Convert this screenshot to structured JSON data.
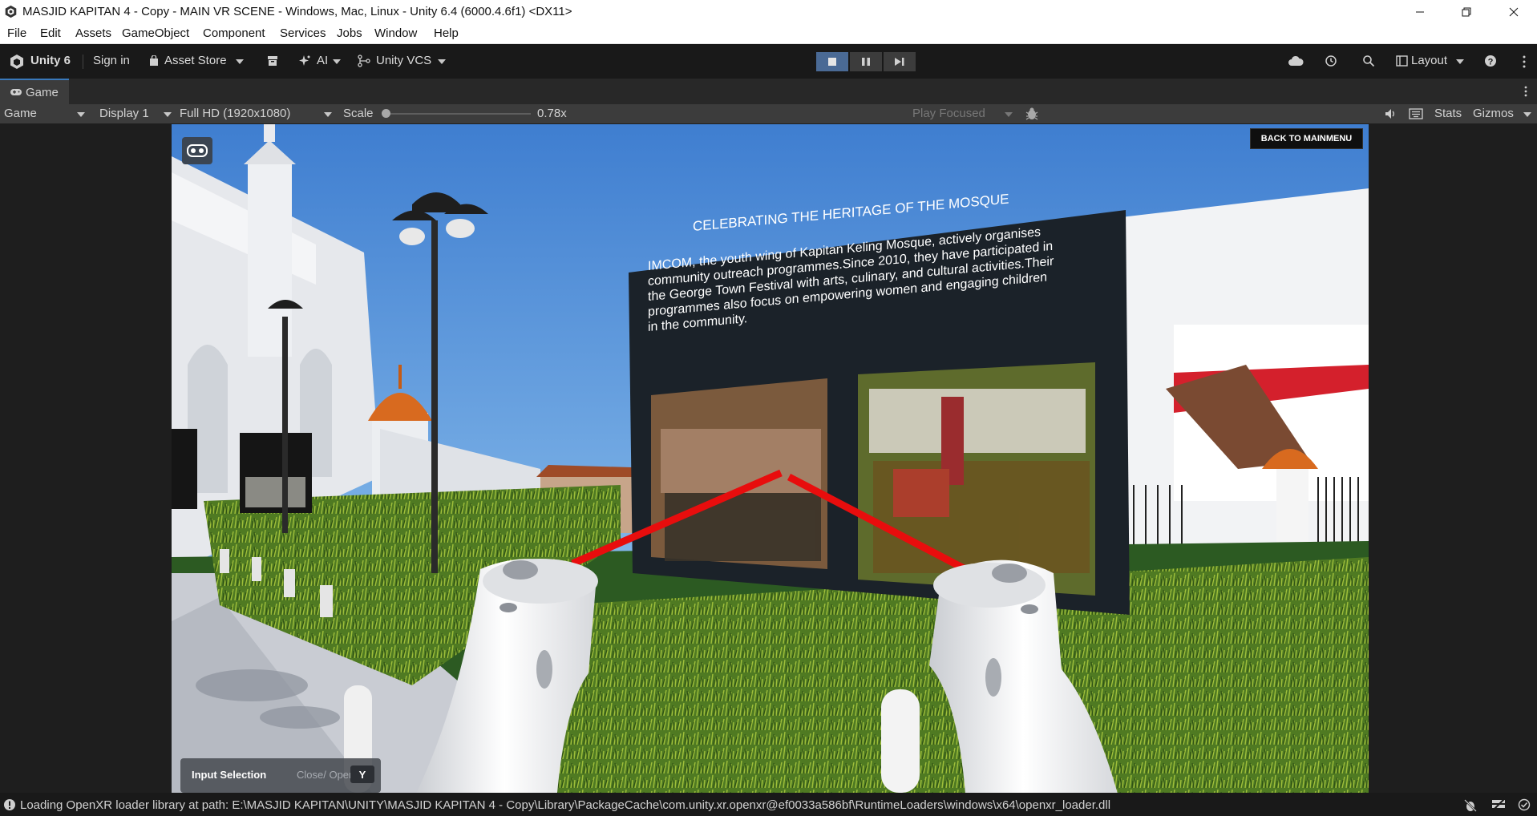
{
  "window": {
    "title": "MASJID KAPITAN 4 - Copy - MAIN VR SCENE - Windows, Mac, Linux - Unity 6.4 (6000.4.6f1) <DX11>"
  },
  "menu": [
    "File",
    "Edit",
    "Assets",
    "GameObject",
    "Component",
    "Services",
    "Jobs",
    "Window",
    "Help"
  ],
  "toolbar": {
    "unity_label": "Unity 6",
    "sign_in": "Sign in",
    "asset_store": "Asset Store",
    "ai": "AI",
    "vcs": "Unity VCS",
    "layout": "Layout"
  },
  "tab": {
    "game": "Game"
  },
  "game_toolbar": {
    "view_mode": "Game",
    "display": "Display 1",
    "resolution": "Full HD (1920x1080)",
    "scale_label": "Scale",
    "scale_value": "0.78x",
    "play_focused": "Play Focused",
    "stats": "Stats",
    "gizmos": "Gizmos"
  },
  "scene": {
    "back_button": "BACK TO MAINMENU",
    "panel_title": "CELEBRATING THE HERITAGE OF THE MOSQUE",
    "panel_body": [
      "IMCOM, the youth wing of Kapitan Keling Mosque, actively organises",
      "community outreach programmes.Since 2010, they have participated in",
      "the George Town Festival with arts, culinary, and cultural activities.Their",
      "programmes also focus on empowering women and engaging children",
      "in the community."
    ],
    "input_selection": {
      "label": "Input Selection",
      "hint": "Close/ Open",
      "key": "Y"
    }
  },
  "status": {
    "message": "Loading OpenXR loader library at path: E:\\MASJID KAPITAN\\UNITY\\MASJID KAPITAN 4 - Copy\\Library\\PackageCache\\com.unity.xr.openxr@ef0033a586bf\\RuntimeLoaders\\windows\\x64\\openxr_loader.dll"
  },
  "colors": {
    "editor_bg": "#191919",
    "toolbar_bg": "#3c3c3c",
    "grass": "#2c5a22",
    "sky": "#5a8fd0",
    "laser": "#e80d0d",
    "panel": "#1b2229"
  }
}
